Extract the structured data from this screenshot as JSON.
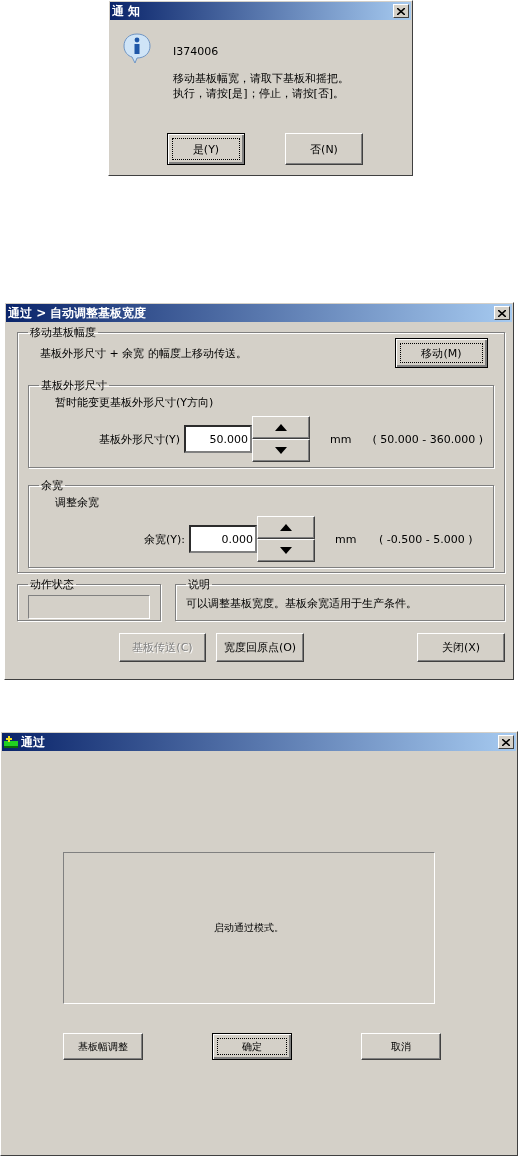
{
  "dialogs": [
    {
      "kind": "message",
      "title": "通 知",
      "code": "I374006",
      "lines": [
        "移动基板幅宽，请取下基板和摇把。",
        "执行，请按[是]；停止，请按[否]。"
      ],
      "buttons": [
        {
          "label": "是(Y)",
          "focused": true,
          "disabled": false
        },
        {
          "label": "否(N)",
          "focused": false,
          "disabled": false
        }
      ]
    },
    {
      "kind": "width_adjust",
      "title": "通过 > 自动调整基板宽度",
      "move_group": {
        "legend": "移动基板幅度",
        "text": "基板外形尺寸 + 余宽 的幅度上移动传送。",
        "button": {
          "label": "移动(M)",
          "focused": true,
          "disabled": false
        },
        "subgroups": [
          {
            "legend": "基板外形尺寸",
            "description": "暂时能变更基板外形尺寸(Y方向)",
            "label": "基板外形尺寸(Y)",
            "value": "50.000",
            "unit": "mm",
            "range": "( 50.000 - 360.000 )"
          },
          {
            "legend": "余宽",
            "description": "调整余宽",
            "label": "余宽(Y):",
            "value": "0.000",
            "unit": "mm",
            "range": "( -0.500 - 5.000 )"
          }
        ]
      },
      "status_group": {
        "legend": "动作状态"
      },
      "note_group": {
        "legend": "说明",
        "text": "可以调整基板宽度。基板余宽适用于生产条件。"
      },
      "buttons": [
        {
          "label": "基板传送(C)",
          "focused": false,
          "disabled": true
        },
        {
          "label": "宽度回原点(O)",
          "focused": false,
          "disabled": false
        },
        {
          "label": "关闭(X)",
          "focused": false,
          "disabled": false
        }
      ]
    },
    {
      "kind": "pass_mode",
      "title": "通过",
      "message": "启动通过模式。",
      "buttons": [
        {
          "label": "基板幅调整",
          "focused": false,
          "disabled": false
        },
        {
          "label": "确定",
          "focused": true,
          "disabled": false
        },
        {
          "label": "取消",
          "focused": false,
          "disabled": false
        }
      ]
    }
  ]
}
